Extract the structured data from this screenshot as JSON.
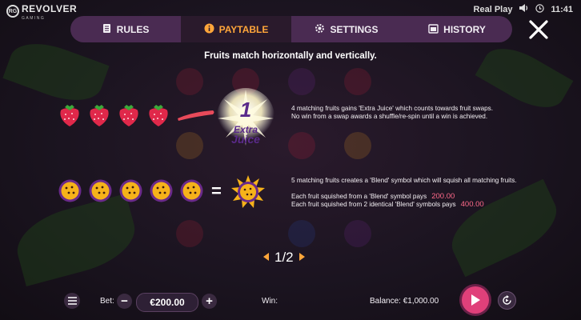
{
  "brand": {
    "name": "REVOLVER",
    "sub": "GAMING",
    "mark": "RG"
  },
  "status": {
    "mode": "Real Play",
    "time": "11:41"
  },
  "tabs": [
    {
      "label": "RULES",
      "icon": "book-icon"
    },
    {
      "label": "PAYTABLE",
      "icon": "info-icon",
      "active": true
    },
    {
      "label": "SETTINGS",
      "icon": "gear-icon"
    },
    {
      "label": "HISTORY",
      "icon": "calendar-icon"
    }
  ],
  "heading": "Fruits match horizontally and vertically.",
  "extra_juice": {
    "count": "1",
    "line1": "Extra",
    "line2": "Juice",
    "desc1": "4 matching fruits gains 'Extra Juice' which counts towards fruit swaps.",
    "desc2": "No win from a swap awards a shuffle/re-spin until a win is achieved."
  },
  "blend": {
    "equals": "=",
    "desc1": "5 matching fruits creates a 'Blend' symbol which will squish all matching fruits.",
    "pay1_label": "Each fruit squished from a 'Blend' symbol pays",
    "pay1_value": "200.00",
    "pay2_label": "Each fruit squished from 2 identical 'Blend' symbols pays",
    "pay2_value": "400.00"
  },
  "pager": {
    "text": "1/2"
  },
  "bottom": {
    "bet_label": "Bet:",
    "bet_value": "€200.00",
    "minus": "−",
    "plus": "+",
    "win_label": "Win:",
    "balance_label": "Balance: €1,000.00"
  },
  "colors": {
    "accent": "#ffa63a",
    "pay": "#ff6a8a",
    "tabs_bg": "#4a2b52",
    "spin": "#e0407a"
  }
}
